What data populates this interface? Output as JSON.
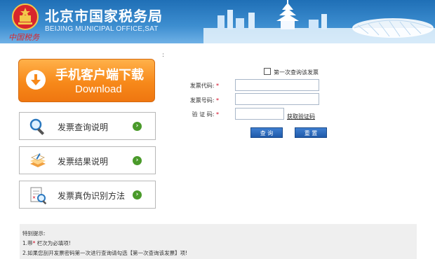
{
  "header": {
    "title": "北京市国家税务局",
    "subtitle": "BEIJING MUNICIPAL OFFICE,SAT",
    "calligraphy": "中国税务"
  },
  "stray_mark": ":",
  "download": {
    "line1": "手机客户端下载",
    "line2": "Download"
  },
  "info_buttons": [
    {
      "label": "发票查询说明",
      "icon": "magnifier-icon"
    },
    {
      "label": "发票结果说明",
      "icon": "document-stack-icon"
    },
    {
      "label": "发票真伪识别方法",
      "icon": "verify-document-icon"
    }
  ],
  "form": {
    "first_query_label": "第一次查询该发票",
    "invoice_code_label": "发票代码:",
    "invoice_number_label": "发票号码:",
    "captcha_label": "验 证 码:",
    "required_mark": "*",
    "invoice_code_value": "",
    "invoice_number_value": "",
    "captcha_value": "",
    "captcha_link": "获取验证码",
    "query_button": "查 询",
    "reset_button": "重 置"
  },
  "notice": {
    "title": "特别提示:",
    "line1_prefix": "1.带",
    "line1_mark": "*",
    "line1_suffix": "栏次为必填项!",
    "line2": "2.如果您刮开发票密码第一次进行查询请勾选【第一次查询该发票】项!"
  },
  "colors": {
    "header_blue": "#2a78bf",
    "orange": "#f7891a",
    "query_blue": "#1f5aaa",
    "arrow_green": "#4a9a2a"
  }
}
